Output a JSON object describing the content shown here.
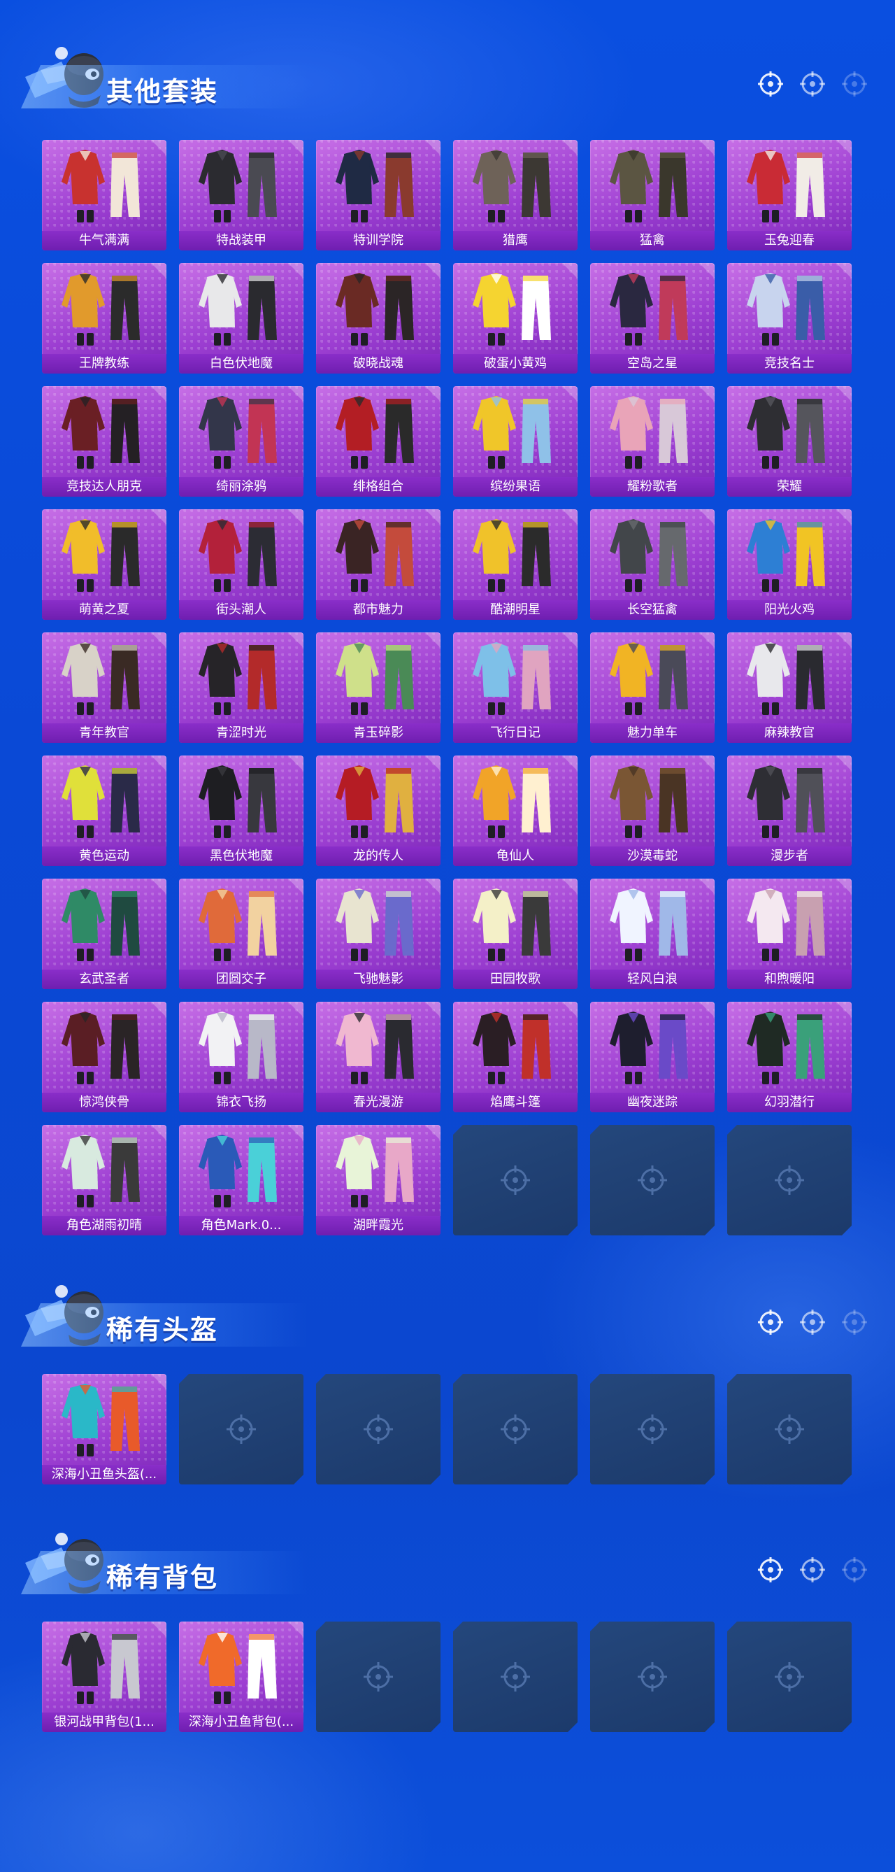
{
  "sections": [
    {
      "title": "其他套装",
      "items": [
        {
          "label": "牛气满满",
          "colors": [
            "#c8322f",
            "#f2e6d8"
          ]
        },
        {
          "label": "特战装甲",
          "colors": [
            "#2b2b30",
            "#4a4a52"
          ]
        },
        {
          "label": "特训学院",
          "colors": [
            "#1f2a44",
            "#8a3a2e"
          ]
        },
        {
          "label": "猎鹰",
          "colors": [
            "#6e6258",
            "#3c3833"
          ]
        },
        {
          "label": "猛禽",
          "colors": [
            "#5b5542",
            "#3a372c"
          ]
        },
        {
          "label": "玉兔迎春",
          "colors": [
            "#c92b35",
            "#f1ece6"
          ]
        },
        {
          "label": "王牌教练",
          "colors": [
            "#e19a2c",
            "#2b2b2b"
          ]
        },
        {
          "label": "白色伏地魔",
          "colors": [
            "#e8e8ea",
            "#2a2a2f"
          ]
        },
        {
          "label": "破晓战魂",
          "colors": [
            "#6a2a24",
            "#2b2526"
          ]
        },
        {
          "label": "破蛋小黄鸡",
          "colors": [
            "#f5d430",
            "#ffffff"
          ]
        },
        {
          "label": "空岛之星",
          "colors": [
            "#2a2840",
            "#c03a5a"
          ]
        },
        {
          "label": "竞技名士",
          "colors": [
            "#c8d4ee",
            "#3a5da8"
          ]
        },
        {
          "label": "竞技达人朋克",
          "colors": [
            "#6a1f24",
            "#242024"
          ]
        },
        {
          "label": "绮丽涂鸦",
          "colors": [
            "#33364a",
            "#c23454"
          ]
        },
        {
          "label": "绯格组合",
          "colors": [
            "#b31e24",
            "#2a2a2a"
          ]
        },
        {
          "label": "缤纷果语",
          "colors": [
            "#f0c629",
            "#8fc1e8"
          ]
        },
        {
          "label": "耀粉歌者",
          "colors": [
            "#e9a4b8",
            "#d8c8d8"
          ]
        },
        {
          "label": "荣耀",
          "colors": [
            "#2e2e33",
            "#55555c"
          ]
        },
        {
          "label": "萌黄之夏",
          "colors": [
            "#f1bd2a",
            "#2a2a2a"
          ]
        },
        {
          "label": "街头潮人",
          "colors": [
            "#b3213a",
            "#2c2c34"
          ]
        },
        {
          "label": "都市魅力",
          "colors": [
            "#3a2424",
            "#c44b3c"
          ]
        },
        {
          "label": "酷潮明星",
          "colors": [
            "#f0c22a",
            "#2b2b2b"
          ]
        },
        {
          "label": "长空猛禽",
          "colors": [
            "#42464a",
            "#66696d"
          ]
        },
        {
          "label": "阳光火鸡",
          "colors": [
            "#2d7fd4",
            "#f1c424"
          ]
        },
        {
          "label": "青年教官",
          "colors": [
            "#d8d2c8",
            "#3a2a24"
          ]
        },
        {
          "label": "青涩时光",
          "colors": [
            "#262428",
            "#b32a2a"
          ]
        },
        {
          "label": "青玉碎影",
          "colors": [
            "#cfe08a",
            "#4a8a56"
          ]
        },
        {
          "label": "飞行日记",
          "colors": [
            "#7ec0e8",
            "#e0a4c0"
          ]
        },
        {
          "label": "魅力单车",
          "colors": [
            "#f1b424",
            "#4a4a58"
          ]
        },
        {
          "label": "麻辣教官",
          "colors": [
            "#e8e8ec",
            "#2a2a30"
          ]
        },
        {
          "label": "黄色运动",
          "colors": [
            "#e0e03a",
            "#2a2a48"
          ]
        },
        {
          "label": "黑色伏地魔",
          "colors": [
            "#1e1e22",
            "#38383e"
          ]
        },
        {
          "label": "龙的传人",
          "colors": [
            "#b51c24",
            "#e0b040"
          ]
        },
        {
          "label": "龟仙人",
          "colors": [
            "#f1a428",
            "#fff0d0"
          ]
        },
        {
          "label": "沙漠毒蛇",
          "colors": [
            "#7a5634",
            "#4a3424"
          ]
        },
        {
          "label": "漫步者",
          "colors": [
            "#2e2e34",
            "#505058"
          ]
        },
        {
          "label": "玄武圣者",
          "colors": [
            "#2f8a66",
            "#1f4a40"
          ]
        },
        {
          "label": "团圆交子",
          "colors": [
            "#e06a3a",
            "#f2d2a0"
          ]
        },
        {
          "label": "飞驰魅影",
          "colors": [
            "#e8e4d0",
            "#6a6acc"
          ]
        },
        {
          "label": "田园牧歌",
          "colors": [
            "#f4f0c8",
            "#3a3a3a"
          ]
        },
        {
          "label": "轻风白浪",
          "colors": [
            "#f0f4ff",
            "#a0b8e8"
          ]
        },
        {
          "label": "和煦暖阳",
          "colors": [
            "#f4e8f0",
            "#c8a0b0"
          ]
        },
        {
          "label": "惊鸿侠骨",
          "colors": [
            "#5a1e24",
            "#2a2426"
          ]
        },
        {
          "label": "锦衣飞扬",
          "colors": [
            "#f2f2f4",
            "#b8b8c8"
          ]
        },
        {
          "label": "春光漫游",
          "colors": [
            "#f0b8d0",
            "#2a2a30"
          ]
        },
        {
          "label": "焰鹰斗篷",
          "colors": [
            "#2a1e24",
            "#c0302a"
          ]
        },
        {
          "label": "幽夜迷踪",
          "colors": [
            "#1e1e2e",
            "#6a4ac8"
          ]
        },
        {
          "label": "幻羽潜行",
          "colors": [
            "#1f2a24",
            "#3aa07a"
          ]
        },
        {
          "label": "角色湖雨初晴",
          "colors": [
            "#d8eadf",
            "#3a3a3a"
          ]
        },
        {
          "label": "角色Mark.0...",
          "colors": [
            "#2a5ab8",
            "#4ad0d8"
          ]
        },
        {
          "label": "湖畔霞光",
          "colors": [
            "#e8f4d8",
            "#e8a8c8"
          ]
        }
      ],
      "empty_slots": 3
    },
    {
      "title": "稀有头盔",
      "items": [
        {
          "label": "深海小丑鱼头盔(...",
          "colors": [
            "#2ab8c8",
            "#e85a2a"
          ]
        }
      ],
      "empty_slots": 5
    },
    {
      "title": "稀有背包",
      "items": [
        {
          "label": "银河战甲背包(1...",
          "colors": [
            "#2a2a32",
            "#c8c8d0"
          ]
        },
        {
          "label": "深海小丑鱼背包(...",
          "colors": [
            "#f06a2a",
            "#ffffff"
          ]
        }
      ],
      "empty_slots": 4
    }
  ]
}
